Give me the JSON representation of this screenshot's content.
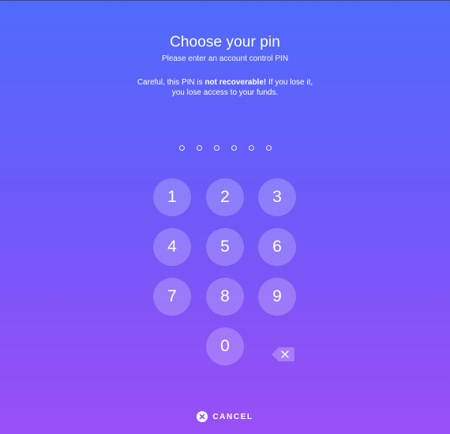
{
  "header": {
    "title": "Choose your pin",
    "subtitle": "Please enter an account control PIN",
    "warning_prefix": "Careful, this PIN is ",
    "warning_bold": "not recoverable!",
    "warning_suffix": " If you lose it,",
    "warning_line2": "you lose access to your funds."
  },
  "pin": {
    "length": 6,
    "entered": 0
  },
  "keypad": {
    "keys": [
      "1",
      "2",
      "3",
      "4",
      "5",
      "6",
      "7",
      "8",
      "9",
      "0"
    ],
    "backspace_icon": "backspace-icon"
  },
  "footer": {
    "cancel_label": "CANCEL",
    "cancel_icon": "close-circle-icon"
  },
  "colors": {
    "gradient_top": "#4f6bfb",
    "gradient_bottom": "#9a4ff6",
    "key_fill": "rgba(255,255,255,0.22)",
    "text": "#ffffff"
  }
}
